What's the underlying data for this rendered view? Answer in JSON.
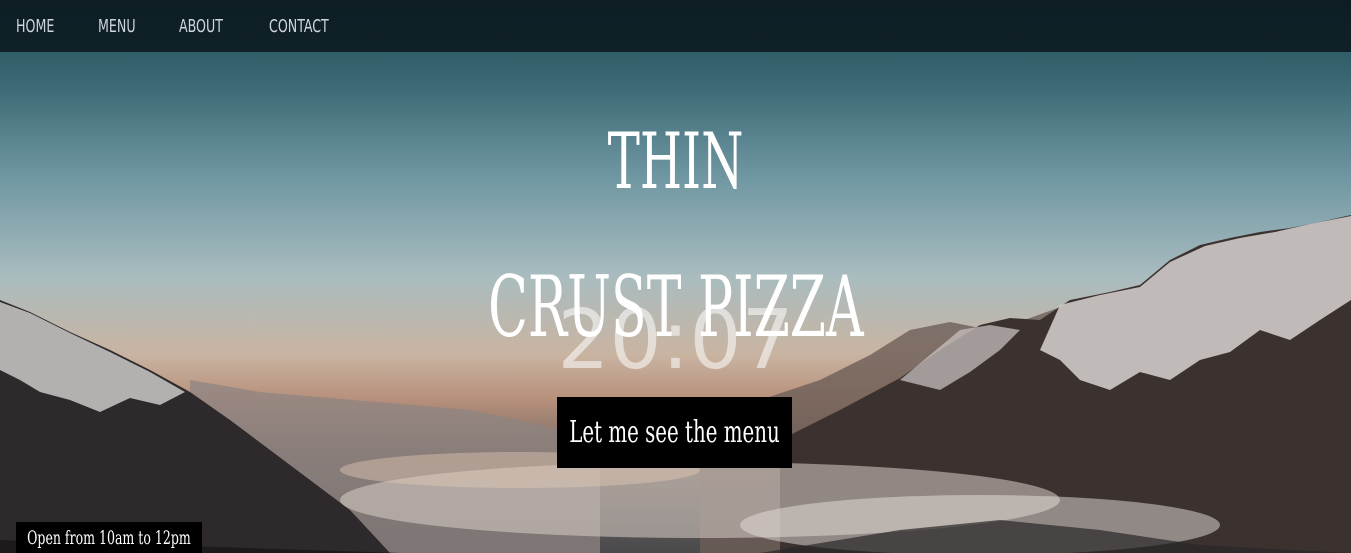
{
  "nav": {
    "items": [
      {
        "label": "HOME"
      },
      {
        "label": "MENU"
      },
      {
        "label": "ABOUT"
      },
      {
        "label": "CONTACT"
      }
    ]
  },
  "hero": {
    "title_line_1": "THIN",
    "title_line_2": "CRUST PIZZA",
    "clock": "20:07",
    "button_label": "Let me see the menu"
  },
  "footer": {
    "hours": "Open from 10am to 12pm"
  },
  "colors": {
    "nav_background": "#0a141a",
    "button_background": "#000000",
    "text": "#ffffff"
  }
}
